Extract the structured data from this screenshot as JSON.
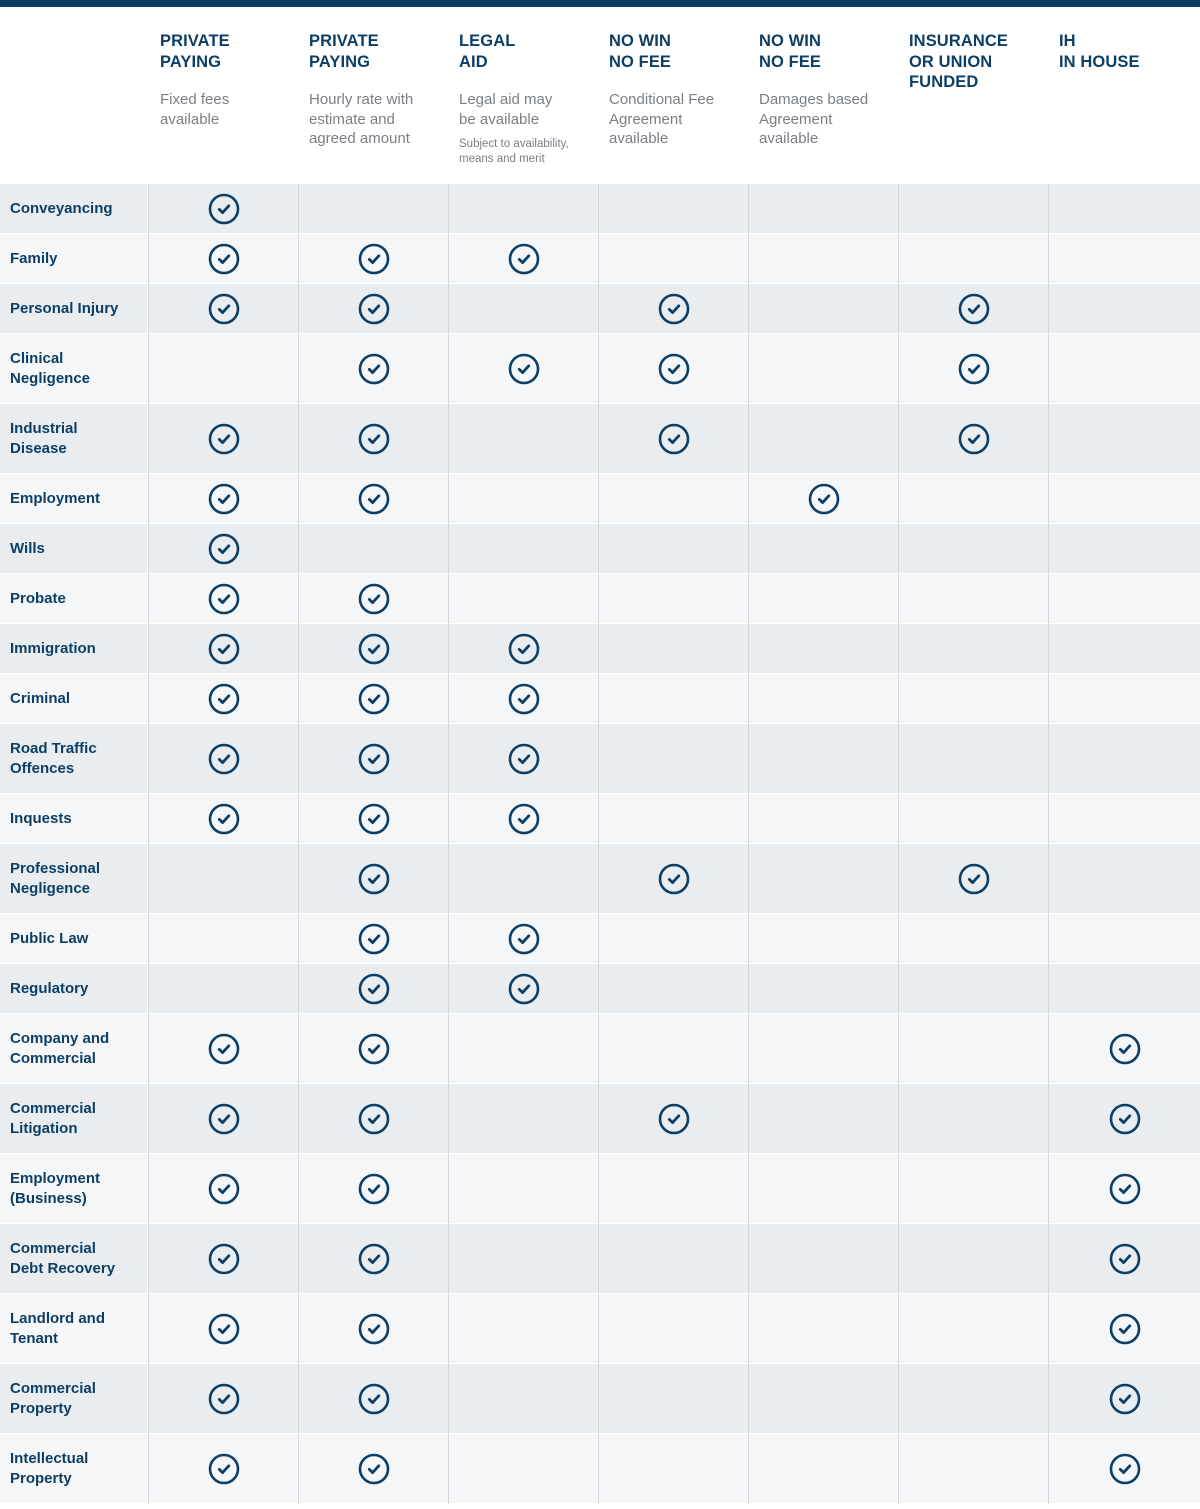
{
  "colors": {
    "brand_navy": "#0d3f66",
    "row_dark": "#e9edf0",
    "row_light": "#f4f6f8",
    "muted_text": "#7a7f85"
  },
  "columns": [
    {
      "title": "PRIVATE\nPAYING",
      "description": "Fixed fees\navailable",
      "note": ""
    },
    {
      "title": "PRIVATE\nPAYING",
      "description": "Hourly rate with\nestimate and\nagreed amount",
      "note": ""
    },
    {
      "title": "LEGAL\nAID",
      "description": "Legal aid may\nbe available",
      "note": "Subject to availability,\nmeans and merit"
    },
    {
      "title": "NO WIN\nNO FEE",
      "description": "Conditional Fee\nAgreement\navailable",
      "note": ""
    },
    {
      "title": "NO WIN\nNO FEE",
      "description": "Damages based\nAgreement\navailable",
      "note": ""
    },
    {
      "title": "INSURANCE\nOR UNION\nFUNDED",
      "description": "",
      "note": ""
    },
    {
      "title": "IH\nIN HOUSE",
      "description": "",
      "note": ""
    }
  ],
  "icon": "check-circle-icon",
  "rows": [
    {
      "label": "Conveyancing",
      "checks": [
        true,
        false,
        false,
        false,
        false,
        false,
        false
      ]
    },
    {
      "label": "Family",
      "checks": [
        true,
        true,
        true,
        false,
        false,
        false,
        false
      ]
    },
    {
      "label": "Personal Injury",
      "checks": [
        true,
        true,
        false,
        true,
        false,
        true,
        false
      ]
    },
    {
      "label": "Clinical\nNegligence",
      "checks": [
        false,
        true,
        true,
        true,
        false,
        true,
        false
      ]
    },
    {
      "label": "Industrial\nDisease",
      "checks": [
        true,
        true,
        false,
        true,
        false,
        true,
        false
      ]
    },
    {
      "label": "Employment",
      "checks": [
        true,
        true,
        false,
        false,
        true,
        false,
        false
      ]
    },
    {
      "label": "Wills",
      "checks": [
        true,
        false,
        false,
        false,
        false,
        false,
        false
      ]
    },
    {
      "label": "Probate",
      "checks": [
        true,
        true,
        false,
        false,
        false,
        false,
        false
      ]
    },
    {
      "label": "Immigration",
      "checks": [
        true,
        true,
        true,
        false,
        false,
        false,
        false
      ]
    },
    {
      "label": "Criminal",
      "checks": [
        true,
        true,
        true,
        false,
        false,
        false,
        false
      ]
    },
    {
      "label": "Road Traffic\nOffences",
      "checks": [
        true,
        true,
        true,
        false,
        false,
        false,
        false
      ]
    },
    {
      "label": "Inquests",
      "checks": [
        true,
        true,
        true,
        false,
        false,
        false,
        false
      ]
    },
    {
      "label": "Professional\nNegligence",
      "checks": [
        false,
        true,
        false,
        true,
        false,
        true,
        false
      ]
    },
    {
      "label": "Public Law",
      "checks": [
        false,
        true,
        true,
        false,
        false,
        false,
        false
      ]
    },
    {
      "label": "Regulatory",
      "checks": [
        false,
        true,
        true,
        false,
        false,
        false,
        false
      ]
    },
    {
      "label": "Company and\nCommercial",
      "checks": [
        true,
        true,
        false,
        false,
        false,
        false,
        true
      ]
    },
    {
      "label": "Commercial\nLitigation",
      "checks": [
        true,
        true,
        false,
        true,
        false,
        false,
        true
      ]
    },
    {
      "label": "Employment\n(Business)",
      "checks": [
        true,
        true,
        false,
        false,
        false,
        false,
        true
      ]
    },
    {
      "label": "Commercial\nDebt Recovery",
      "checks": [
        true,
        true,
        false,
        false,
        false,
        false,
        true
      ]
    },
    {
      "label": "Landlord and\nTenant",
      "checks": [
        true,
        true,
        false,
        false,
        false,
        false,
        true
      ]
    },
    {
      "label": "Commercial\nProperty",
      "checks": [
        true,
        true,
        false,
        false,
        false,
        false,
        true
      ]
    },
    {
      "label": "Intellectual\nProperty",
      "checks": [
        true,
        true,
        false,
        false,
        false,
        false,
        true
      ]
    }
  ]
}
